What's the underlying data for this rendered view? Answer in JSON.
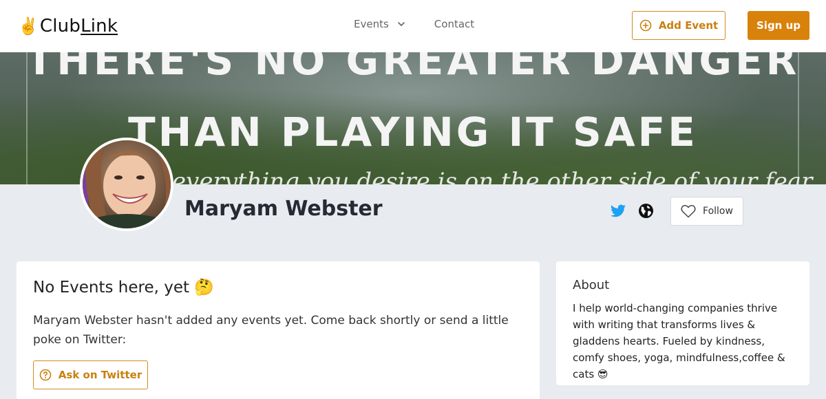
{
  "header": {
    "logo_emoji": "✌️",
    "logo_text_a": "Club",
    "logo_text_b": "Link",
    "nav": [
      {
        "label": "Events",
        "has_dropdown": true
      },
      {
        "label": "Contact"
      }
    ],
    "add_event_label": "Add Event",
    "signup_label": "Sign up"
  },
  "banner": {
    "line1": "THERE'S NO GREATER DANGER",
    "line2": "THAN PLAYING IT SAFE",
    "script": "everything you desire is on the other side of your fear"
  },
  "profile": {
    "name": "Maryam Webster",
    "follow_label": "Follow",
    "icons": [
      "twitter-icon",
      "globe-icon",
      "heart-icon"
    ]
  },
  "events": {
    "title": "No Events here, yet 🤔",
    "message": "Maryam Webster hasn't added any events yet. Come back shortly or send a little poke on Twitter:",
    "ask_label": "Ask on Twitter"
  },
  "about": {
    "title": "About",
    "text": "I help world-changing companies thrive with writing that transforms lives & gladdens hearts. Fueled by kindness, comfy shoes, yoga, mindfulness,coffee & cats 😎"
  },
  "colors": {
    "accent": "#d9820b",
    "twitter": "#1da1f2",
    "background": "#e8ebef"
  }
}
